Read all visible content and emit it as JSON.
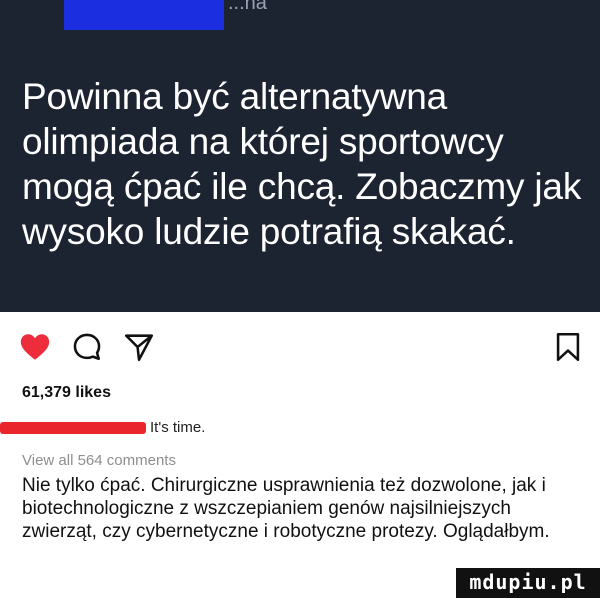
{
  "post": {
    "header_fragment": "...na",
    "caption_image_text": "Powinna być alternatywna olimpiada  na której sportowcy mogą ćpać ile chcą. Zobaczmy jak wysoko ludzie potrafią skakać."
  },
  "actions": {
    "like_icon": "heart-filled-icon",
    "comment_icon": "comment-bubble-icon",
    "share_icon": "send-icon",
    "save_icon": "bookmark-icon",
    "like_color": "#ed2d3b"
  },
  "likes": {
    "count_text": "61,379 likes"
  },
  "caption": {
    "text": "It's time."
  },
  "comments": {
    "view_all": "View all 564 comments",
    "top_comment": "Nie tylko ćpać. Chirurgiczne usprawnienia też dozwolone, jak i biotechnologiczne z wszczepianiem genów najsilniejszych zwierząt, czy cybernetyczne i robotyczne protezy. Oglądałbym."
  },
  "watermark": {
    "text": "mdupiu.pl"
  }
}
